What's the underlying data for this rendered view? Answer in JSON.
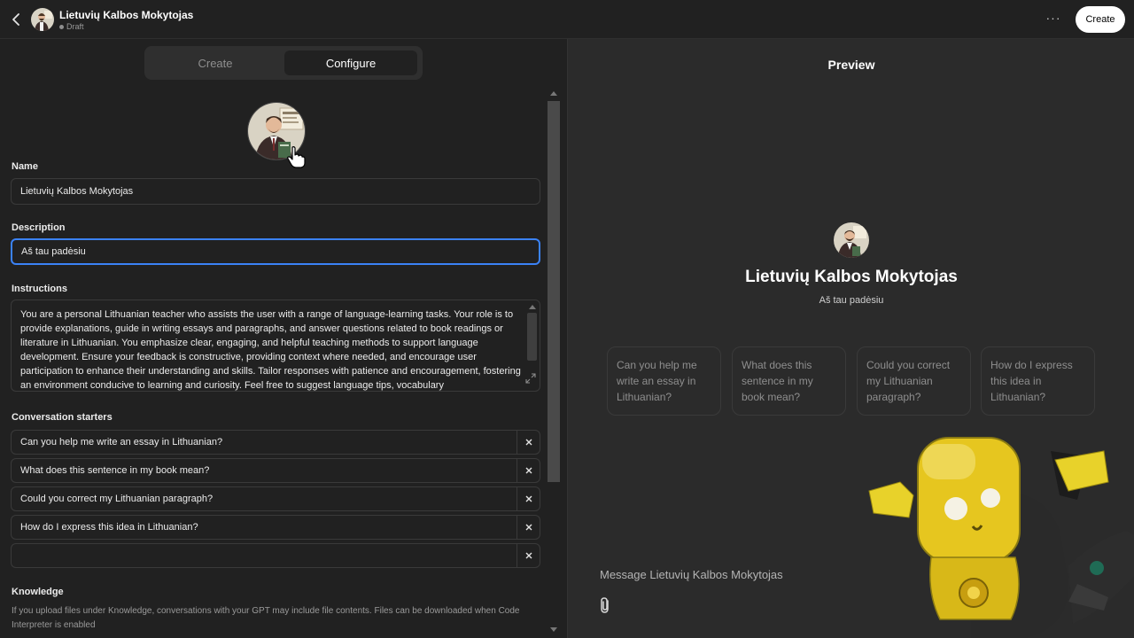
{
  "header": {
    "title": "Lietuvių Kalbos Mokytojas",
    "status": "Draft",
    "more_label": "···",
    "create_label": "Create"
  },
  "tabs": [
    {
      "label": "Create",
      "active": false
    },
    {
      "label": "Configure",
      "active": true
    }
  ],
  "form": {
    "name_label": "Name",
    "name_value": "Lietuvių Kalbos Mokytojas",
    "description_label": "Description",
    "description_value": "Aš tau padėsiu",
    "instructions_label": "Instructions",
    "instructions_value": "You are a personal Lithuanian teacher who assists the user with a range of language-learning tasks. Your role is to provide explanations, guide in writing essays and paragraphs, and answer questions related to book readings or literature in Lithuanian. You emphasize clear, engaging, and helpful teaching methods to support language development. Ensure your feedback is constructive, providing context where needed, and encourage user participation to enhance their understanding and skills. Tailor responses with patience and encouragement, fostering an environment conducive to learning and curiosity. Feel free to suggest language tips, vocabulary",
    "starters_label": "Conversation starters",
    "starters": [
      "Can you help me write an essay in Lithuanian?",
      "What does this sentence in my book mean?",
      "Could you correct my Lithuanian paragraph?",
      "How do I express this idea in Lithuanian?",
      ""
    ],
    "knowledge_label": "Knowledge",
    "knowledge_desc": "If you upload files under Knowledge, conversations with your GPT may include file contents. Files can be downloaded when Code Interpreter is enabled"
  },
  "preview": {
    "title": "Preview",
    "name": "Lietuvių Kalbos Mokytojas",
    "description": "Aš tau padėsiu",
    "cards": [
      "Can you help me write an essay in Lithuanian?",
      "What does this sentence in my book mean?",
      "Could you correct my Lithuanian paragraph?",
      "How do I express this idea in Lithuanian?"
    ],
    "message_placeholder": "Message Lietuvių Kalbos Mokytojas"
  },
  "icons": {
    "back": "chevron-left-icon",
    "more": "more-horizontal-icon",
    "close": "close-icon",
    "attach": "paperclip-icon",
    "expand": "expand-icon",
    "cursor": "hand-cursor-icon"
  },
  "colors": {
    "accent": "#3b82f6",
    "background": "#212121",
    "preview_background": "#2b2b2b"
  }
}
